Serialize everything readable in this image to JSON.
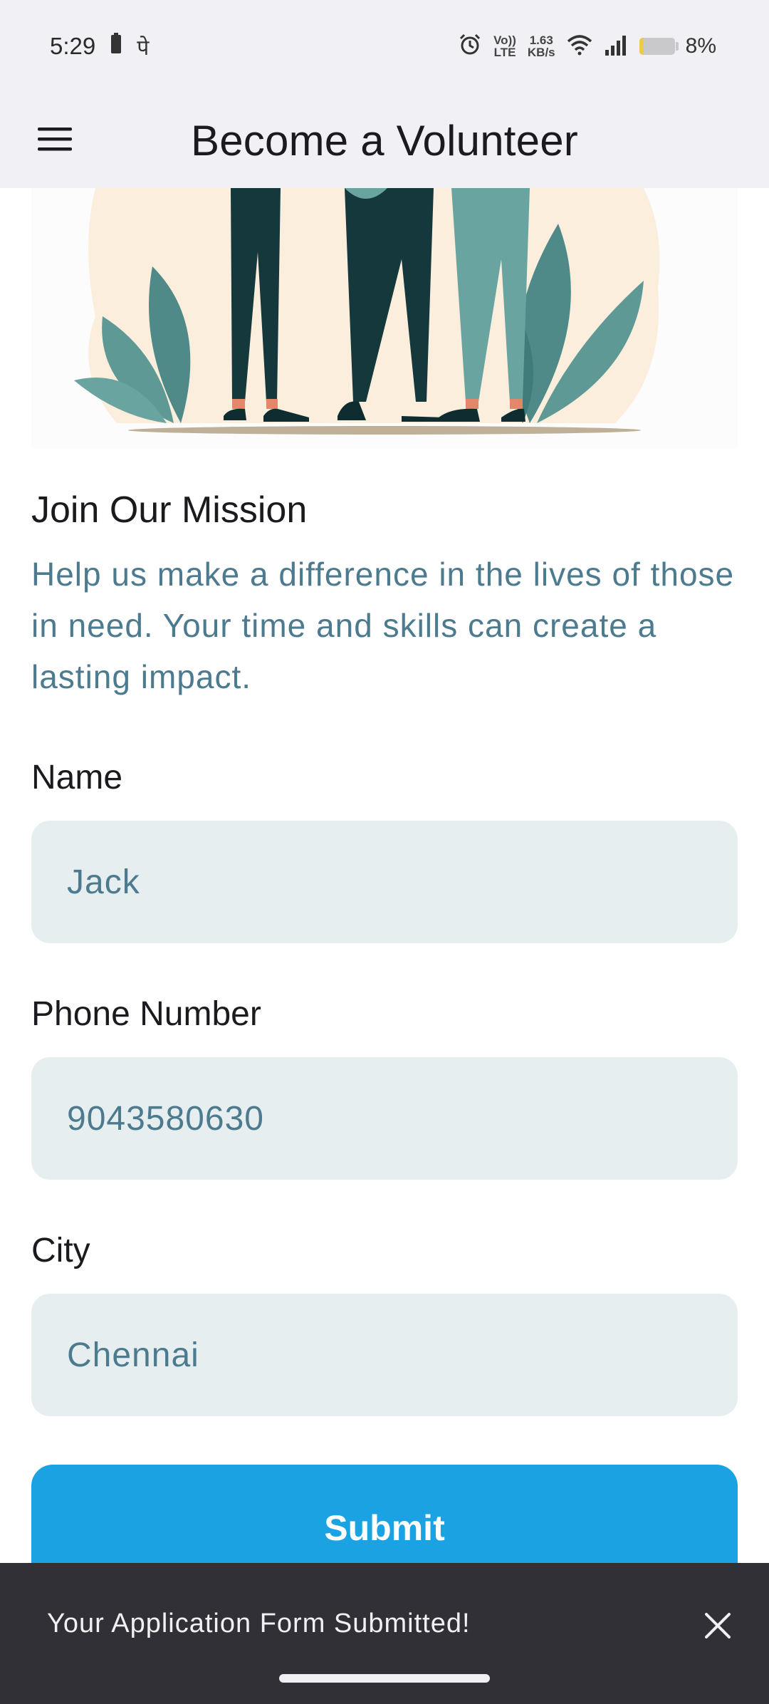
{
  "status_bar": {
    "time": "5:29",
    "left_glyph": "पे",
    "volte_top": "Vo))",
    "volte_bottom": "LTE",
    "net_speed_top": "1.63",
    "net_speed_bottom": "KB/s",
    "battery_percent": "8%",
    "battery_level": 0.08,
    "icons": [
      "battery-saver-icon",
      "alarm-icon",
      "wifi-icon",
      "signal-icon",
      "battery-icon"
    ]
  },
  "app_bar": {
    "title": "Become a Volunteer",
    "menu_icon": "hamburger-menu-icon"
  },
  "intro": {
    "title": "Join Our Mission",
    "description": "Help us make a difference in the lives of those in need. Your time and skills can create a lasting impact."
  },
  "form": {
    "name": {
      "label": "Name",
      "value": "Jack"
    },
    "phone": {
      "label": "Phone Number",
      "value": "9043580630"
    },
    "city": {
      "label": "City",
      "value": "Chennai"
    },
    "submit_label": "Submit"
  },
  "snackbar": {
    "message": "Your Application Form Submitted!",
    "close_icon": "close-icon"
  },
  "colors": {
    "accent": "#1aa2e3",
    "field_bg": "#e6eef0",
    "field_text": "#4c7a8f",
    "snackbar_bg": "#313036",
    "app_bar_bg": "#f1f1f5"
  }
}
